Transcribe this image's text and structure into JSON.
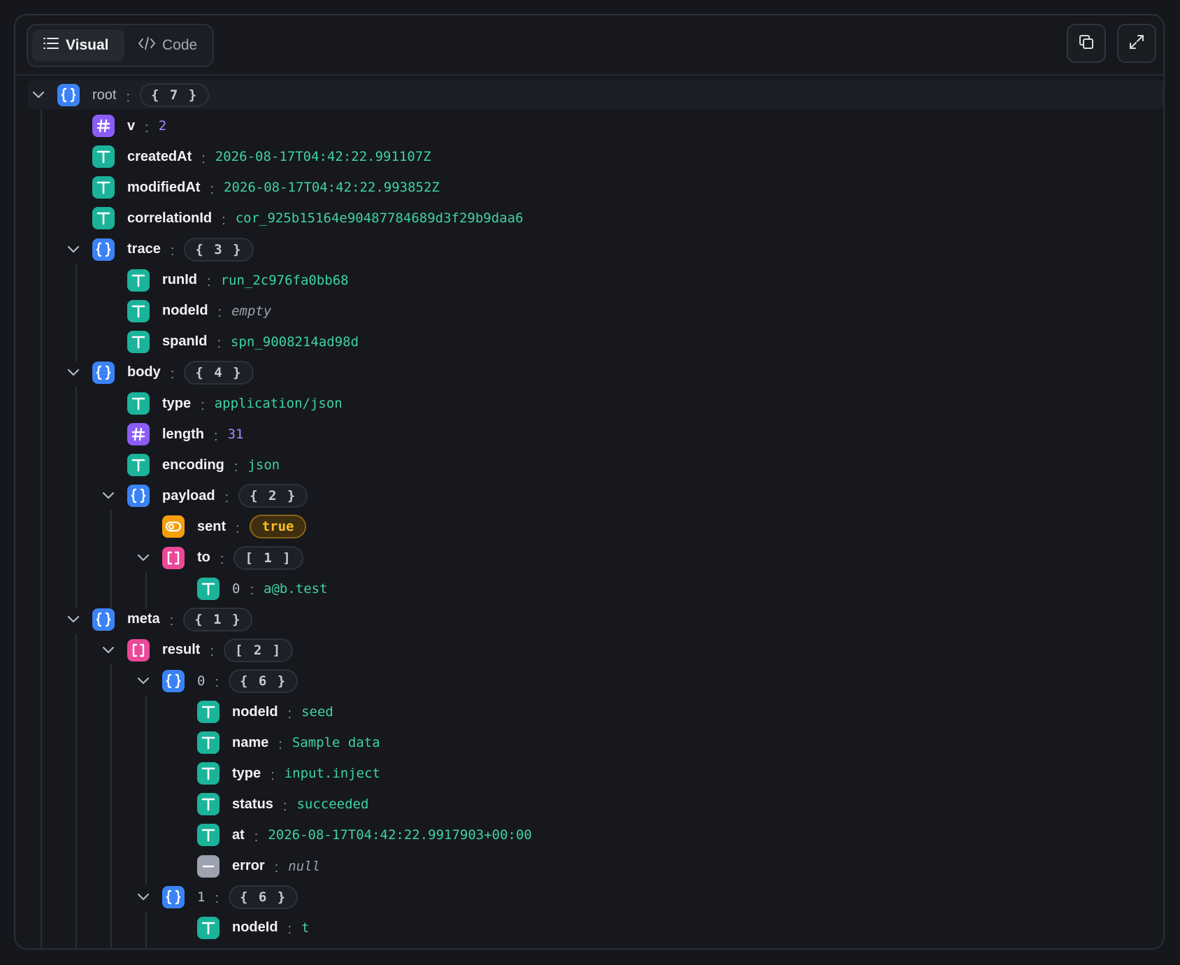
{
  "toolbar": {
    "tabs": [
      {
        "label": "Visual",
        "active": true
      },
      {
        "label": "Code",
        "active": false
      }
    ],
    "copy_icon": "copy-icon",
    "expand_icon": "expand-icon"
  },
  "colors": {
    "string": "#1bb39a",
    "number": "#8b5cf6",
    "object": "#3b82f6",
    "array": "#ec4899",
    "boolean": "#f59e0b",
    "null": "#9ca3af"
  },
  "tree": [
    {
      "kind": "object",
      "key": "root",
      "count": "{ 7 }"
    },
    {
      "kind": "number",
      "key": "v",
      "value": "2"
    },
    {
      "kind": "string",
      "key": "createdAt",
      "value": "2026-08-17T04:42:22.991107Z"
    },
    {
      "kind": "string",
      "key": "modifiedAt",
      "value": "2026-08-17T04:42:22.993852Z"
    },
    {
      "kind": "string",
      "key": "correlationId",
      "value": "cor_925b15164e90487784689d3f29b9daa6"
    },
    {
      "kind": "object",
      "key": "trace",
      "count": "{ 3 }"
    },
    {
      "kind": "string",
      "key": "runId",
      "value": "run_2c976fa0bb68"
    },
    {
      "kind": "string",
      "key": "nodeId",
      "value": "empty",
      "empty": true
    },
    {
      "kind": "string",
      "key": "spanId",
      "value": "spn_9008214ad98d"
    },
    {
      "kind": "object",
      "key": "body",
      "count": "{ 4 }"
    },
    {
      "kind": "string",
      "key": "type",
      "value": "application/json"
    },
    {
      "kind": "number",
      "key": "length",
      "value": "31"
    },
    {
      "kind": "string",
      "key": "encoding",
      "value": "json"
    },
    {
      "kind": "object",
      "key": "payload",
      "count": "{ 2 }"
    },
    {
      "kind": "boolean",
      "key": "sent",
      "value": "true"
    },
    {
      "kind": "array",
      "key": "to",
      "count": "[ 1 ]"
    },
    {
      "kind": "string",
      "key": "0",
      "value": "a@b.test"
    },
    {
      "kind": "object",
      "key": "meta",
      "count": "{ 1 }"
    },
    {
      "kind": "array",
      "key": "result",
      "count": "[ 2 ]"
    },
    {
      "kind": "object",
      "key": "0",
      "count": "{ 6 }"
    },
    {
      "kind": "string",
      "key": "nodeId",
      "value": "seed"
    },
    {
      "kind": "string",
      "key": "name",
      "value": "Sample data"
    },
    {
      "kind": "string",
      "key": "type",
      "value": "input.inject"
    },
    {
      "kind": "string",
      "key": "status",
      "value": "succeeded"
    },
    {
      "kind": "string",
      "key": "at",
      "value": "2026-08-17T04:42:22.9917903+00:00"
    },
    {
      "kind": "null",
      "key": "error",
      "value": "null"
    },
    {
      "kind": "object",
      "key": "1",
      "count": "{ 6 }"
    },
    {
      "kind": "string",
      "key": "nodeId",
      "value": "t"
    }
  ]
}
